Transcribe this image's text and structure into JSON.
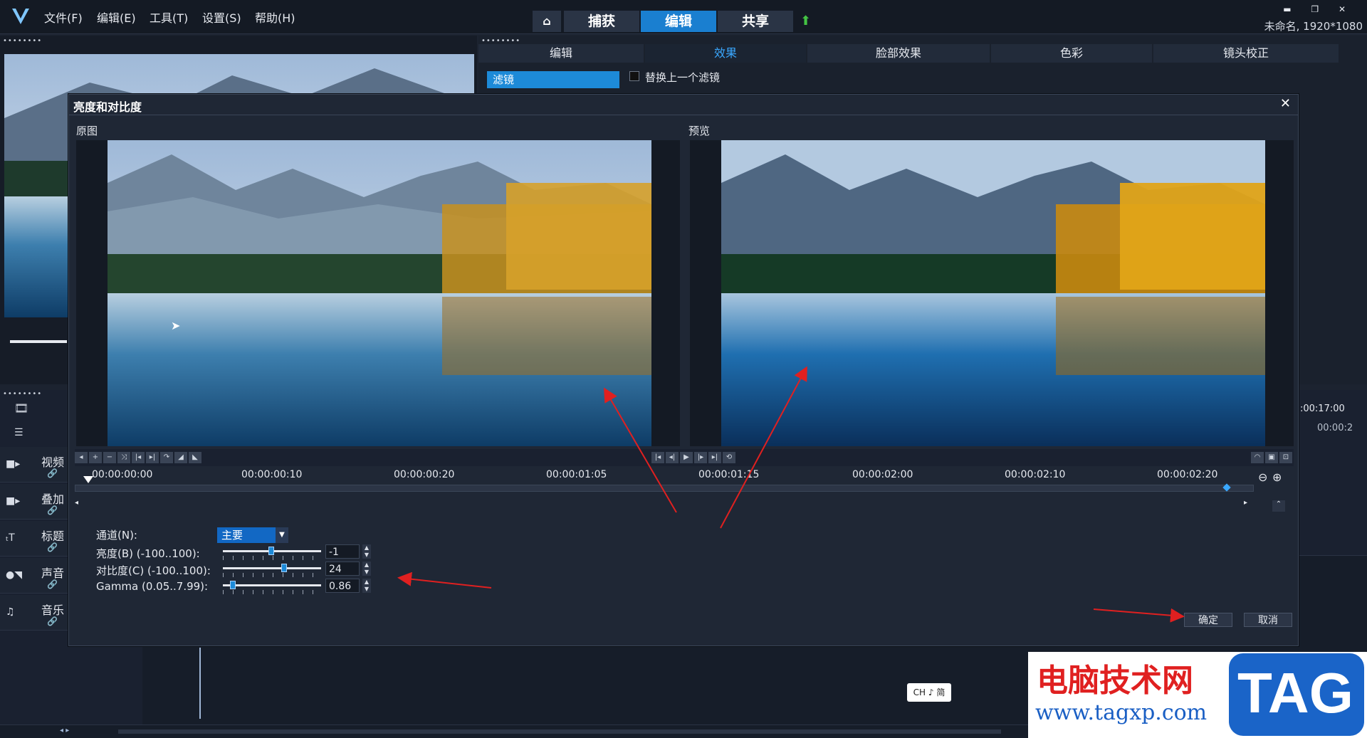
{
  "menu": {
    "items": [
      "文件(F)",
      "编辑(E)",
      "工具(T)",
      "设置(S)",
      "帮助(H)"
    ]
  },
  "mode_tabs": {
    "home_icon": "home-icon",
    "capture": "捕获",
    "edit": "编辑",
    "share": "共享",
    "upload_icon": "upload-arrow-icon"
  },
  "window": {
    "project_info": "未命名, 1920*1080"
  },
  "effect_panel": {
    "tabs": [
      "编辑",
      "效果",
      "脸部效果",
      "色彩",
      "镜头校正"
    ],
    "active_tab": "效果",
    "filter_label": "滤镜",
    "replace_label": "替换上一个滤镜"
  },
  "tracks": [
    {
      "label": "视频",
      "icon": "video-track-icon"
    },
    {
      "label": "叠加",
      "icon": "overlay-track-icon"
    },
    {
      "label": "标题",
      "icon": "title-track-icon"
    },
    {
      "label": "声音",
      "icon": "voice-track-icon"
    },
    {
      "label": "音乐",
      "icon": "music-track-icon"
    }
  ],
  "timeline_right": {
    "timecode_a": ":00:17:00",
    "timecode_b": "00:00:2"
  },
  "dialog": {
    "title": "亮度和对比度",
    "original_label": "原图",
    "preview_label": "预览",
    "ruler_ticks": [
      "00:00:00:00",
      "00:00:00:10",
      "00:00:00:20",
      "00:00:01:05",
      "00:00:01:15",
      "00:00:02:00",
      "00:00:02:10",
      "00:00:02:20"
    ],
    "params": {
      "channel_label": "通道(N):",
      "channel_value": "主要",
      "brightness_label": "亮度(B) (-100..100):",
      "brightness_value": "-1",
      "brightness_level": -1,
      "contrast_label": "对比度(C) (-100..100):",
      "contrast_value": "24",
      "contrast_level": 24,
      "gamma_label": "Gamma (0.05..7.99):",
      "gamma_value": "0.86",
      "gamma_level": 0.86
    },
    "ok_button": "确定",
    "cancel_button": "取消"
  },
  "ime": {
    "text": "CH ♪ 简"
  },
  "watermark": {
    "line1": "电脑技术网",
    "line2": "www.tagxp.com",
    "tag": "TAG"
  },
  "colors": {
    "accent": "#1d8ad8",
    "annotation": "#e02020",
    "background": "#1c2330"
  }
}
